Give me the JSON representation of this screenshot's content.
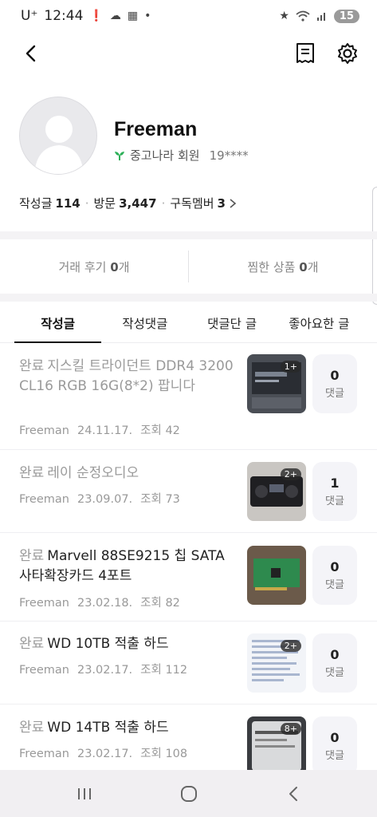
{
  "status_bar": {
    "carrier": "U⁺",
    "time": "12:44",
    "battery": "15",
    "icons": [
      "alert-icon",
      "cloud-icon",
      "gallery-icon",
      "dot-icon",
      "star-icon",
      "wifi-icon",
      "signal-icon"
    ]
  },
  "profile": {
    "username": "Freeman",
    "member_label": "중고나라 회원",
    "member_id": "19****",
    "stats": {
      "posts_label": "작성글",
      "posts_value": "114",
      "visits_label": "방문",
      "visits_value": "3,447",
      "subs_label": "구독멤버",
      "subs_value": "3"
    }
  },
  "reviews": {
    "trade_label": "거래 후기",
    "trade_value": "0",
    "trade_unit": "개",
    "wish_label": "찜한 상품",
    "wish_value": "0",
    "wish_unit": "개"
  },
  "tabs": [
    {
      "label": "작성글",
      "active": true
    },
    {
      "label": "작성댓글",
      "active": false
    },
    {
      "label": "댓글단 글",
      "active": false
    },
    {
      "label": "좋아요한 글",
      "active": false
    }
  ],
  "posts": [
    {
      "badge": "완료",
      "title": "지스킬 트라이던트 DDR4 3200 CL16 RGB 16G(8*2) 팝니다",
      "author": "Freeman",
      "date": "24.11.17.",
      "views": "조회 42",
      "thumb_count": "1+",
      "comments": "0",
      "comments_label": "댓글"
    },
    {
      "badge": "완료",
      "title": "레이 순정오디오",
      "author": "Freeman",
      "date": "23.09.07.",
      "views": "조회 73",
      "thumb_count": "2+",
      "comments": "1",
      "comments_label": "댓글"
    },
    {
      "badge": "완료",
      "title": "Marvell 88SE9215 칩 SATA 사타확장카드 4포트",
      "author": "Freeman",
      "date": "23.02.18.",
      "views": "조회 82",
      "thumb_count": "",
      "comments": "0",
      "comments_label": "댓글"
    },
    {
      "badge": "완료",
      "title": "WD 10TB 적출 하드",
      "author": "Freeman",
      "date": "23.02.17.",
      "views": "조회 112",
      "thumb_count": "2+",
      "comments": "0",
      "comments_label": "댓글"
    },
    {
      "badge": "완료",
      "title": "WD 14TB 적출 하드",
      "author": "Freeman",
      "date": "23.02.17.",
      "views": "조회 108",
      "thumb_count": "8+",
      "comments": "0",
      "comments_label": "댓글"
    }
  ],
  "colors": {
    "accent_green": "#2fb15a",
    "band": "#f4f3f5",
    "muted": "#9a9a9a"
  }
}
